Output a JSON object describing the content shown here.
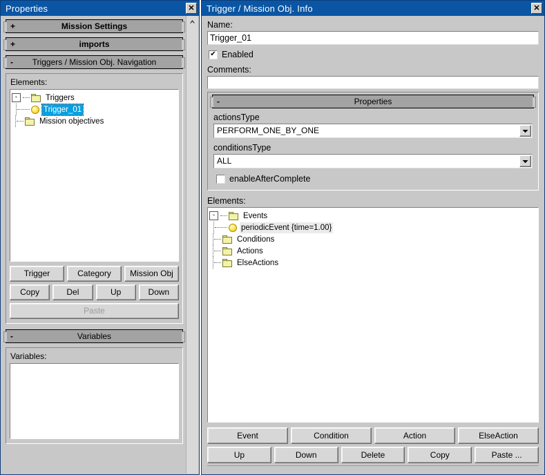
{
  "left_window": {
    "title": "Properties",
    "close_label": "✕",
    "sections": [
      {
        "toggle": "+",
        "label": "Mission Settings",
        "expanded": false
      },
      {
        "toggle": "+",
        "label": "imports",
        "expanded": false
      },
      {
        "toggle": "-",
        "label": "Triggers / Mission Obj. Navigation",
        "expanded": true
      }
    ],
    "elements_label": "Elements:",
    "tree": [
      {
        "label": "Triggers",
        "icon": "folder-icon",
        "expander": "-",
        "depth": 0,
        "state": "none"
      },
      {
        "label": "Trigger_01",
        "icon": "circle-icon",
        "expander": "",
        "depth": 1,
        "state": "selected"
      },
      {
        "label": "Mission objectives",
        "icon": "folder-icon",
        "expander": "",
        "depth": 0,
        "state": "none"
      }
    ],
    "buttons_row1": [
      {
        "label": "Trigger",
        "disabled": false
      },
      {
        "label": "Category",
        "disabled": false
      },
      {
        "label": "Mission Obj",
        "disabled": false
      }
    ],
    "buttons_row2": [
      {
        "label": "Copy",
        "disabled": false
      },
      {
        "label": "Del",
        "disabled": false
      },
      {
        "label": "Up",
        "disabled": false
      },
      {
        "label": "Down",
        "disabled": false
      }
    ],
    "paste_button": {
      "label": "Paste",
      "disabled": true
    },
    "variables_section": {
      "toggle": "-",
      "label": "Variables"
    },
    "variables_label": "Variables:",
    "variables_items": []
  },
  "right_window": {
    "title": "Trigger / Mission Obj. Info",
    "close_label": "✕",
    "name_label": "Name:",
    "name_value": "Trigger_01",
    "enabled_checkbox": {
      "label": "Enabled",
      "checked": true,
      "mark": "✔"
    },
    "comments_label": "Comments:",
    "comments_value": "",
    "properties_section": {
      "toggle": "-",
      "label": "Properties"
    },
    "actions_type": {
      "label": "actionsType",
      "value": "PERFORM_ONE_BY_ONE",
      "options": [
        "PERFORM_ONE_BY_ONE"
      ]
    },
    "conditions_type": {
      "label": "conditionsType",
      "value": "ALL",
      "options": [
        "ALL"
      ]
    },
    "enable_after_complete": {
      "label": "enableAfterComplete",
      "checked": false,
      "mark": ""
    },
    "elements_label": "Elements:",
    "tree": [
      {
        "label": "Events",
        "icon": "folder-icon",
        "expander": "-",
        "depth": 0,
        "state": "none"
      },
      {
        "label": "periodicEvent {time=1.00}",
        "icon": "circle-icon",
        "expander": "",
        "depth": 1,
        "state": "soft-selected"
      },
      {
        "label": "Conditions",
        "icon": "folder-icon",
        "expander": "",
        "depth": 0,
        "state": "none"
      },
      {
        "label": "Actions",
        "icon": "folder-icon",
        "expander": "",
        "depth": 0,
        "state": "none"
      },
      {
        "label": "ElseActions",
        "icon": "folder-icon",
        "expander": "",
        "depth": 0,
        "state": "none"
      }
    ],
    "buttons_row1": [
      {
        "label": "Event"
      },
      {
        "label": "Condition"
      },
      {
        "label": "Action"
      },
      {
        "label": "ElseAction"
      }
    ],
    "buttons_row2": [
      {
        "label": "Up"
      },
      {
        "label": "Down"
      },
      {
        "label": "Delete"
      },
      {
        "label": "Copy"
      },
      {
        "label": "Paste ..."
      }
    ]
  },
  "colors": {
    "titlebar": "#0a56a4",
    "window_bg": "#c8c8c8",
    "section_bar": "#a3a3a3",
    "selection": "#0a9fe0",
    "folder": "#f2f2a8"
  }
}
